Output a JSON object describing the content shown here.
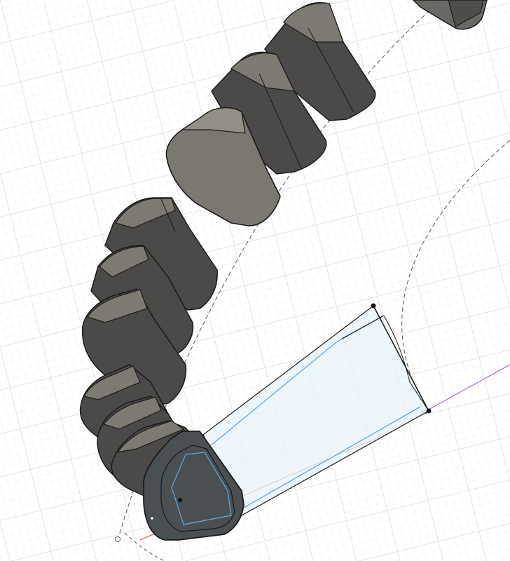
{
  "app": {
    "view": "3d-viewport"
  },
  "colors": {
    "background": "#ffffff",
    "grid_minor": "#e8e8e8",
    "grid_major": "#cfcfcf",
    "body_dark": "#4a4a48",
    "body_mid": "#6d6c67",
    "body_light": "#8a8880",
    "body_face": "#7e7c74",
    "edge": "#1a1a1a",
    "sketch_fill": "#e6f3fa",
    "sketch_line": "#5aaee0",
    "axis_red": "#e04040",
    "axis_purple": "#9b59d0",
    "path_dash": "#555555"
  },
  "scene": {
    "segment_count": 12,
    "sketch_profile": "selected",
    "path_type": "arc"
  }
}
